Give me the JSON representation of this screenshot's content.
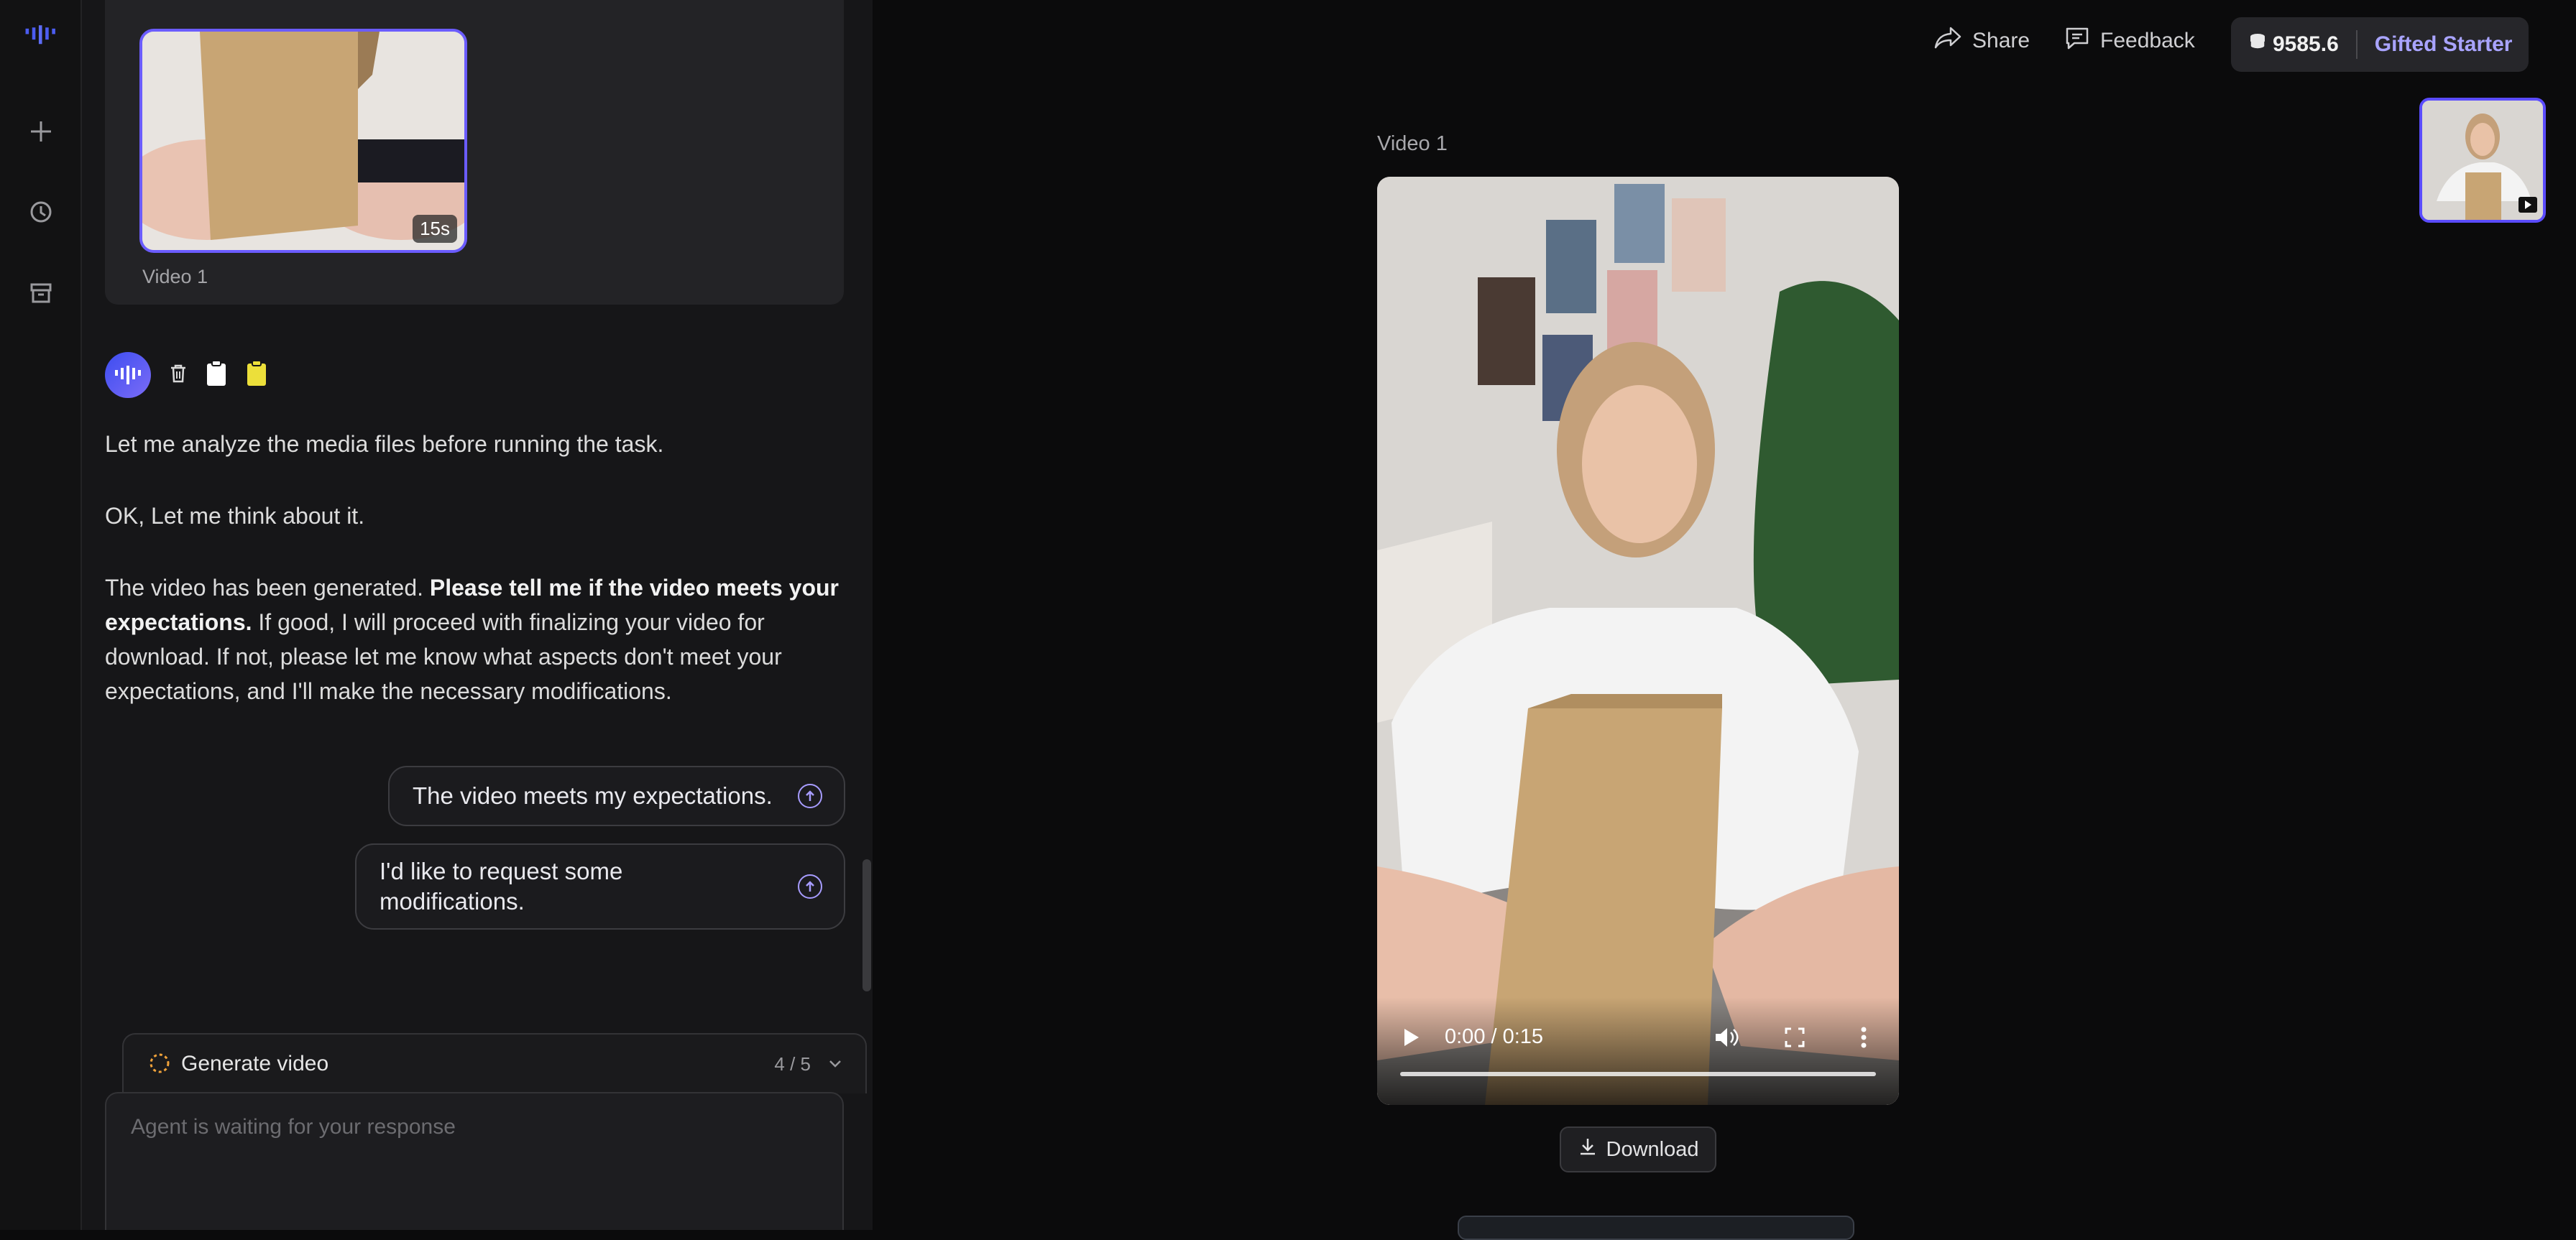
{
  "rail": {
    "icons": [
      "logo-icon",
      "plus-icon",
      "history-icon",
      "archive-icon"
    ]
  },
  "chat": {
    "media_card": {
      "duration": "15s",
      "caption": "Video 1"
    },
    "paragraph_1": "Let me analyze the media files before running the task.",
    "paragraph_2": "OK, Let me think about it.",
    "paragraph_3": {
      "lead": "The video has been generated. ",
      "bold": "Please tell me if the video meets your expectations.",
      "rest": " If good, I will proceed with finalizing your video for download. If not, please let me know what aspects don't meet your expectations, and I'll make the necessary modifications."
    },
    "suggestions": [
      "The video meets my expectations.",
      "I'd like to request some modifications."
    ],
    "task": {
      "label": "Generate video",
      "progress": "4 / 5"
    },
    "input": {
      "placeholder": "Agent is waiting for your response"
    }
  },
  "topbar": {
    "share_label": "Share",
    "feedback_label": "Feedback",
    "credits": "9585.6",
    "plan": "Gifted Starter"
  },
  "preview": {
    "title": "Video 1",
    "time": "0:00 / 0:15",
    "download_label": "Download"
  },
  "colors": {
    "accent": "#6b5cff",
    "plan_text": "#a9a4ff",
    "task_spinner": "#f0a23a"
  }
}
